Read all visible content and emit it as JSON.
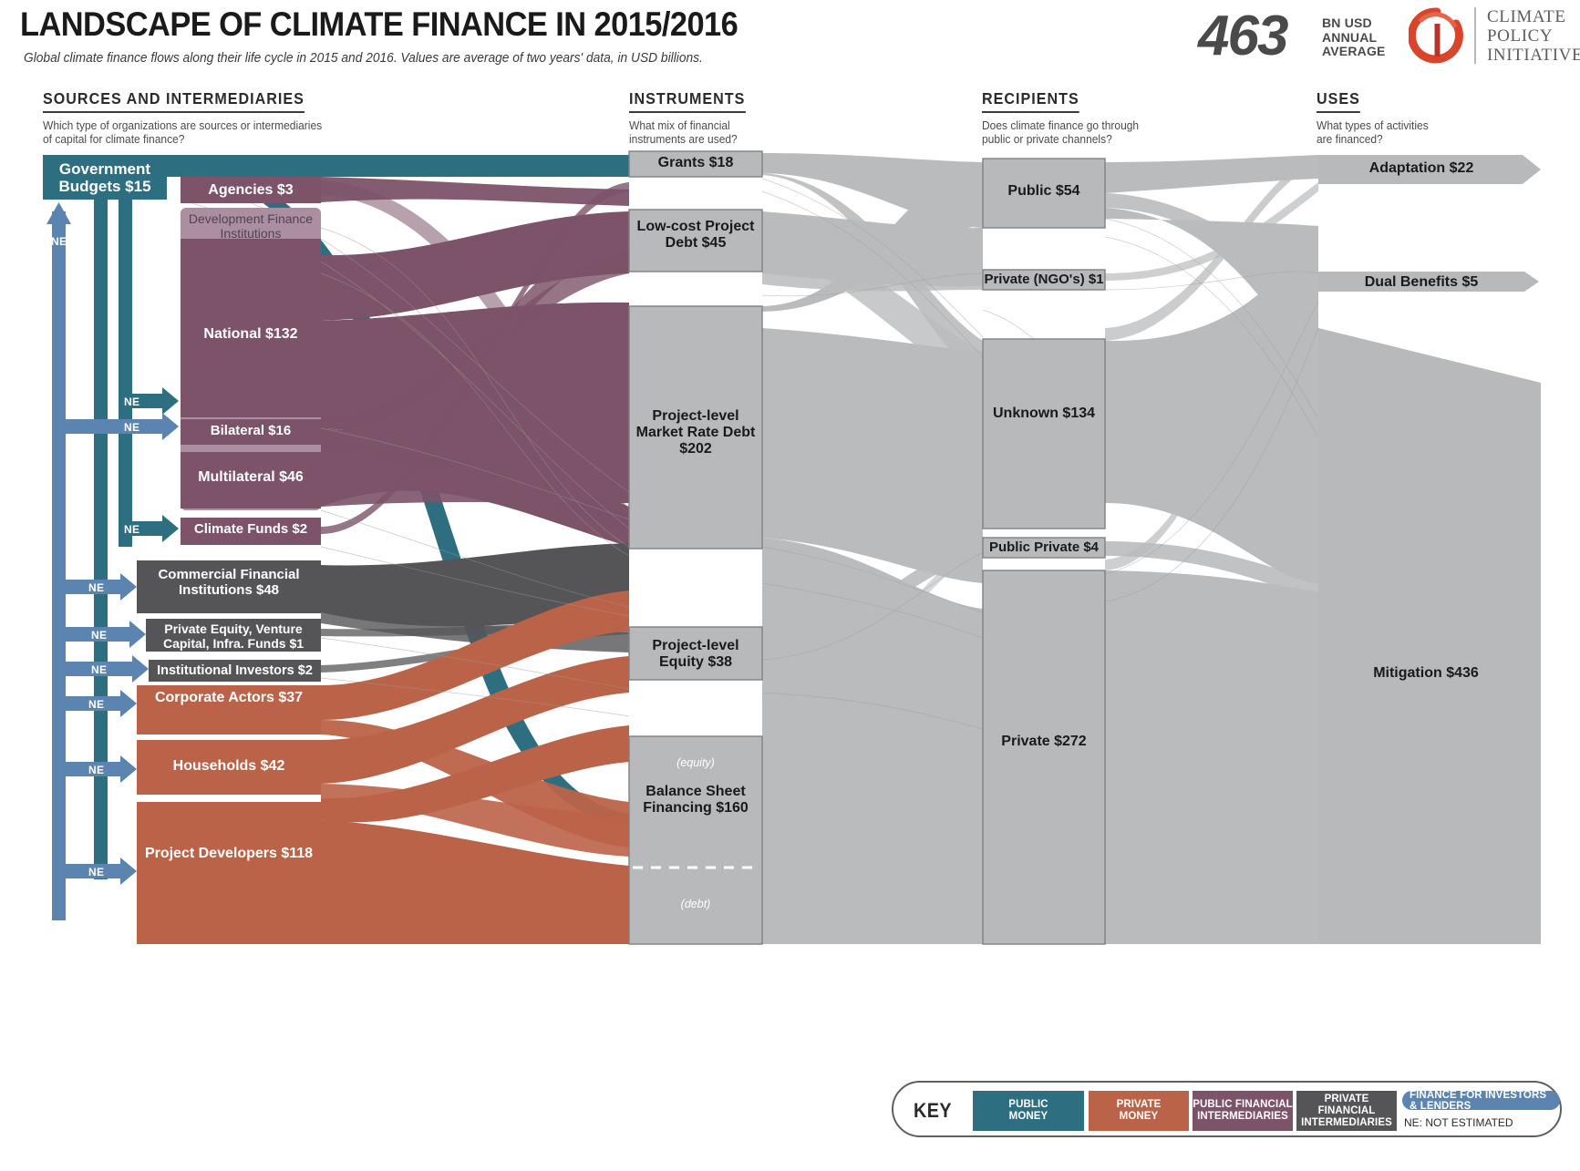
{
  "header": {
    "title": "LANDSCAPE OF CLIMATE FINANCE IN 2015/2016",
    "subtitle": "Global climate finance flows along their life cycle in 2015 and 2016. Values are average of two years' data, in USD billions.",
    "big_number": "463",
    "big_unit": "BN USD\nANNUAL\nAVERAGE",
    "big_unit_lines": [
      "BN USD",
      "ANNUAL",
      "AVERAGE"
    ],
    "logo_name": "CLIMATE\nPOLICY\nINITIATIVE",
    "logo_lines": [
      "CLIMATE",
      "POLICY",
      "INITIATIVE"
    ],
    "logo_icon": "cpi-swirl-icon"
  },
  "columns": [
    {
      "id": "sources",
      "title": "SOURCES AND INTERMEDIARIES",
      "subtitle": "Which type of organizations are sources or intermediaries\nof capital for climate finance?"
    },
    {
      "id": "instruments",
      "title": "INSTRUMENTS",
      "subtitle": "What mix of financial\ninstruments are used?"
    },
    {
      "id": "recipients",
      "title": "RECIPIENTS",
      "subtitle": "Does climate finance go through\npublic or private channels?"
    },
    {
      "id": "uses",
      "title": "USES",
      "subtitle": "What types of activities\nare financed?"
    }
  ],
  "colors": {
    "public_money": "#2d6e80",
    "private_money": "#bb6348",
    "public_fin_int": "#7c5369",
    "public_fin_int_light": "#ab8fa0",
    "private_fin_int": "#555558",
    "flow_grey": "#b9bbbd",
    "investor_blue": "#5b84b1",
    "node_grey": "#b7b9bb",
    "node_grey_stroke": "#7e8083"
  },
  "legend": {
    "key_label": "KEY",
    "items": [
      {
        "label": "PUBLIC\nMONEY",
        "lines": [
          "PUBLIC",
          "MONEY"
        ],
        "color": "#2d6e80"
      },
      {
        "label": "PRIVATE\nMONEY",
        "lines": [
          "PRIVATE",
          "MONEY"
        ],
        "color": "#bb6348"
      },
      {
        "label": "PUBLIC FINANCIAL\nINTERMEDIARIES",
        "lines": [
          "PUBLIC FINANCIAL",
          "INTERMEDIARIES"
        ],
        "color": "#7c5369"
      },
      {
        "label": "PRIVATE FINANCIAL\nINTERMEDIARIES",
        "lines": [
          "PRIVATE FINANCIAL",
          "INTERMEDIARIES"
        ],
        "color": "#555558"
      }
    ],
    "pill_label": "FINANCE FOR INVESTORS & LENDERS",
    "ne_note": "NE: NOT ESTIMATED"
  },
  "chart_data": {
    "type": "sankey",
    "title": "Landscape of Climate Finance in 2015/2016",
    "unit": "USD billions (two-year average)",
    "total": 463,
    "stages": [
      "Sources and Intermediaries",
      "Instruments",
      "Recipients",
      "Uses"
    ],
    "nodes": [
      {
        "id": "gov_budgets",
        "stage": 0,
        "label": "Government Budgets $15",
        "name": "Government Budgets",
        "value": 15,
        "color": "#2d6e80",
        "category": "public_money"
      },
      {
        "id": "agencies",
        "stage": 0,
        "label": "Agencies $3",
        "name": "Agencies",
        "value": 3,
        "color": "#7c5369",
        "category": "public_fin_int"
      },
      {
        "id": "dfi_group",
        "stage": 0,
        "label": "Development Finance Institutions",
        "name": "Development Finance Institutions",
        "value": 194,
        "color": "#ab8fa0",
        "category": "public_fin_int_group"
      },
      {
        "id": "national",
        "stage": 0,
        "label": "National $132",
        "name": "National",
        "value": 132,
        "color": "#7c5369",
        "category": "public_fin_int"
      },
      {
        "id": "bilateral",
        "stage": 0,
        "label": "Bilateral $16",
        "name": "Bilateral",
        "value": 16,
        "color": "#7c5369",
        "category": "public_fin_int"
      },
      {
        "id": "multilateral",
        "stage": 0,
        "label": "Multilateral $46",
        "name": "Multilateral",
        "value": 46,
        "color": "#7c5369",
        "category": "public_fin_int"
      },
      {
        "id": "climate_funds",
        "stage": 0,
        "label": "Climate Funds $2",
        "name": "Climate Funds",
        "value": 2,
        "color": "#7c5369",
        "category": "public_fin_int"
      },
      {
        "id": "cfi",
        "stage": 0,
        "label": "Commercial Financial Institutions $48",
        "name": "Commercial Financial Institutions",
        "value": 48,
        "color": "#555558",
        "category": "private_fin_int"
      },
      {
        "id": "pe_vc",
        "stage": 0,
        "label": "Private Equity, Venture Capital, Infra. Funds $1",
        "name": "Private Equity, Venture Capital, Infra. Funds",
        "value": 1,
        "color": "#555558",
        "category": "private_fin_int"
      },
      {
        "id": "inst_inv",
        "stage": 0,
        "label": "Institutional Investors $2",
        "name": "Institutional Investors",
        "value": 2,
        "color": "#555558",
        "category": "private_fin_int"
      },
      {
        "id": "corporate",
        "stage": 0,
        "label": "Corporate Actors $37",
        "name": "Corporate Actors",
        "value": 37,
        "color": "#bb6348",
        "category": "private_money"
      },
      {
        "id": "households",
        "stage": 0,
        "label": "Households $42",
        "name": "Households",
        "value": 42,
        "color": "#bb6348",
        "category": "private_money"
      },
      {
        "id": "project_dev",
        "stage": 0,
        "label": "Project Developers $118",
        "name": "Project Developers",
        "value": 118,
        "color": "#bb6348",
        "category": "private_money"
      },
      {
        "id": "grants",
        "stage": 1,
        "label": "Grants $18",
        "name": "Grants",
        "value": 18,
        "color": "#b7b9bb"
      },
      {
        "id": "lowcost_debt",
        "stage": 1,
        "label": "Low-cost Project Debt $45",
        "name": "Low-cost Project Debt",
        "value": 45,
        "color": "#b7b9bb"
      },
      {
        "id": "market_debt",
        "stage": 1,
        "label": "Project-level Market Rate Debt $202",
        "name": "Project-level Market Rate Debt",
        "value": 202,
        "color": "#b7b9bb"
      },
      {
        "id": "project_eq",
        "stage": 1,
        "label": "Project-level Equity $38",
        "name": "Project-level Equity",
        "value": 38,
        "color": "#b7b9bb"
      },
      {
        "id": "balance_sheet",
        "stage": 1,
        "label": "Balance Sheet Financing $160",
        "name": "Balance Sheet Financing",
        "value": 160,
        "color": "#b7b9bb",
        "sublabels": [
          "(equity)",
          "(debt)"
        ]
      },
      {
        "id": "public_rec",
        "stage": 2,
        "label": "Public $54",
        "name": "Public",
        "value": 54,
        "color": "#b7b9bb"
      },
      {
        "id": "private_ngo",
        "stage": 2,
        "label": "Private (NGO's) $1",
        "name": "Private (NGO's)",
        "value": 1,
        "color": "#b7b9bb"
      },
      {
        "id": "unknown_rec",
        "stage": 2,
        "label": "Unknown $134",
        "name": "Unknown",
        "value": 134,
        "color": "#b7b9bb"
      },
      {
        "id": "public_private",
        "stage": 2,
        "label": "Public Private $4",
        "name": "Public Private",
        "value": 4,
        "color": "#b7b9bb"
      },
      {
        "id": "private_rec",
        "stage": 2,
        "label": "Private $272",
        "name": "Private",
        "value": 272,
        "color": "#b7b9bb"
      },
      {
        "id": "adaptation",
        "stage": 3,
        "label": "Adaptation $22",
        "name": "Adaptation",
        "value": 22,
        "color": "#b7b9bb"
      },
      {
        "id": "dual",
        "stage": 3,
        "label": "Dual Benefits $5",
        "name": "Dual Benefits",
        "value": 5,
        "color": "#b7b9bb"
      },
      {
        "id": "mitigation",
        "stage": 3,
        "label": "Mitigation $436",
        "name": "Mitigation",
        "value": 436,
        "color": "#b7b9bb"
      }
    ],
    "ne_flows": [
      {
        "from": "finance_for_investors",
        "to": "agencies",
        "label": "NE"
      },
      {
        "from": "finance_for_investors",
        "to": "bilateral",
        "label": "NE"
      },
      {
        "from": "finance_for_investors",
        "to": "climate_funds",
        "label": "NE"
      },
      {
        "from": "finance_for_investors",
        "to": "cfi",
        "label": "NE"
      },
      {
        "from": "finance_for_investors",
        "to": "pe_vc",
        "label": "NE"
      },
      {
        "from": "finance_for_investors",
        "to": "inst_inv",
        "label": "NE"
      },
      {
        "from": "finance_for_investors",
        "to": "corporate",
        "label": "NE"
      },
      {
        "from": "finance_for_investors",
        "to": "households",
        "label": "NE"
      },
      {
        "from": "finance_for_investors",
        "to": "project_dev",
        "label": "NE"
      },
      {
        "from": "gov_budgets",
        "to": "return_loop",
        "label": "NE"
      }
    ]
  }
}
